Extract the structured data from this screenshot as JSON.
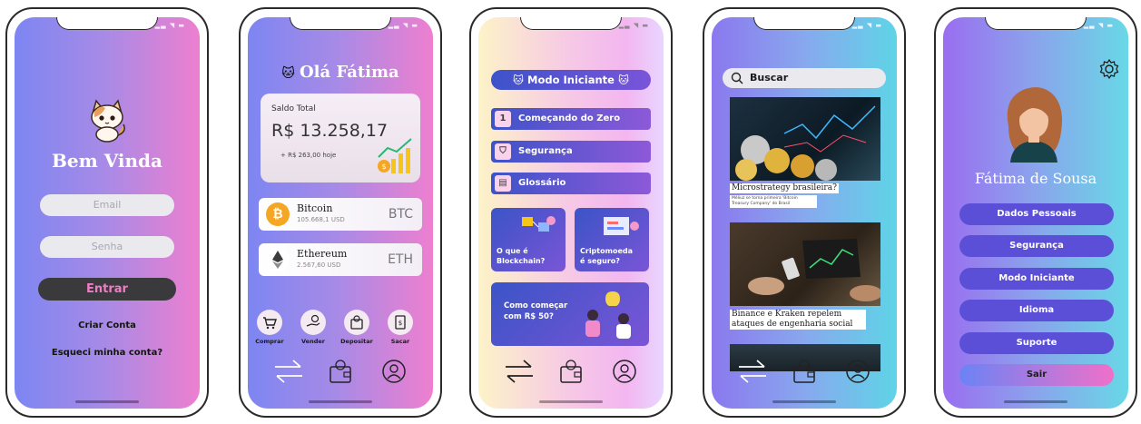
{
  "login": {
    "title": "Bem Vinda",
    "email_placeholder": "Email",
    "password_placeholder": "Senha",
    "enter_label": "Entrar",
    "create_account": "Criar Conta",
    "forgot_account": "Esqueci minha conta?"
  },
  "wallet": {
    "greeting": "Olá Fátima",
    "balance_label": "Saldo Total",
    "balance_value": "R$ 13.258,17",
    "balance_change": "+ R$ 263,00 hoje",
    "coins": [
      {
        "name": "Bitcoin",
        "value": "105.668,1 USD",
        "ticker": "BTC",
        "color": "#f5a623"
      },
      {
        "name": "Ethereum",
        "value": "2.567,60 USD",
        "ticker": "ETH",
        "color": "#3c3c3d"
      }
    ],
    "actions": [
      "Comprar",
      "Vender",
      "Depositar",
      "Sacar"
    ]
  },
  "beginner": {
    "title": "Modo Iniciante",
    "menu": [
      {
        "label": "Começando do  Zero",
        "icon": "1"
      },
      {
        "label": "Segurança",
        "icon": "shield-icon"
      },
      {
        "label": "Glossário",
        "icon": "book-icon"
      }
    ],
    "tiles": [
      {
        "line1": "O que é",
        "line2": "Blockchain?"
      },
      {
        "line1": "Criptomoeda",
        "line2": "é seguro?"
      }
    ],
    "wide_tile": {
      "line1": "Como começar",
      "line2": "com R$ 50?"
    }
  },
  "news": {
    "search_label": "Buscar",
    "items": [
      {
        "title": "Microstrategy brasileira?",
        "subtitle": "Méliuz se torna primeira 'Bitcoin Treasury Company' do Brasil"
      },
      {
        "title": "Binance e Kraken repelem ataques de engenharia social",
        "subtitle": ""
      }
    ]
  },
  "profile": {
    "name": "Fátima de Sousa",
    "buttons": [
      "Dados Pessoais",
      "Segurança",
      "Modo Iniciante",
      "Idioma",
      "Suporte"
    ],
    "logout": "Sair"
  },
  "colors": {
    "accent_pink": "#f07cc8",
    "button_dark": "#3a3a3c",
    "menu_blue": "#3e53c9",
    "profile_button": "#5a4fd6"
  }
}
